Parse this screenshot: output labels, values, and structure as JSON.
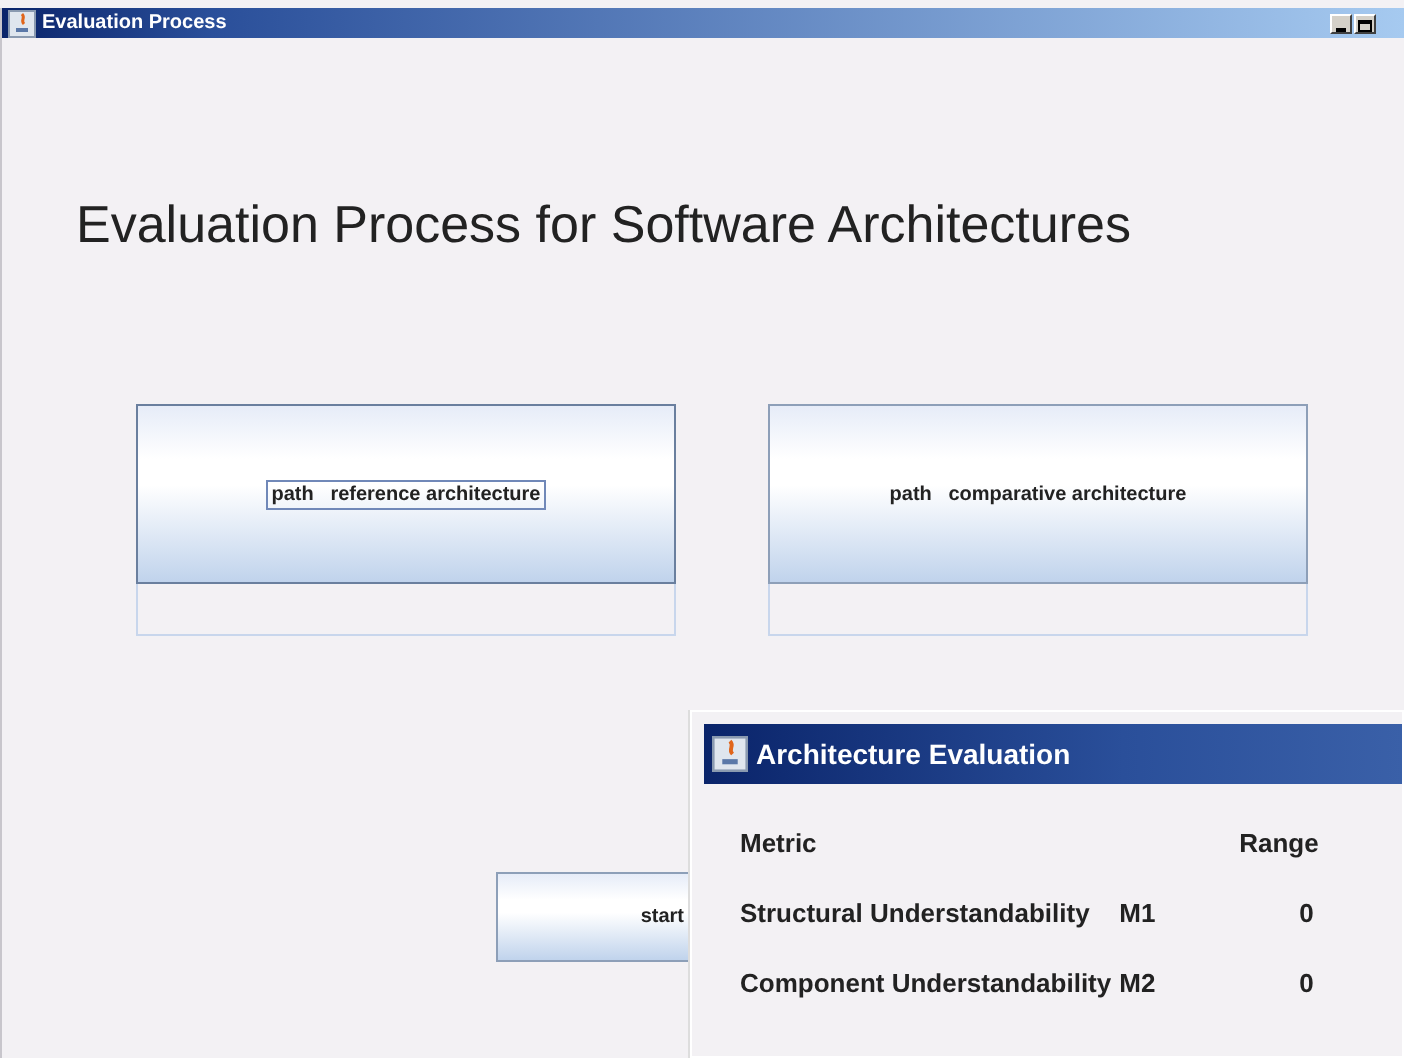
{
  "window": {
    "title": "Evaluation Process"
  },
  "heading": "Evaluation Process for Software Architectures",
  "path_buttons": [
    {
      "label": "path   reference architecture",
      "focused": true
    },
    {
      "label": "path   comparative architecture",
      "focused": false
    }
  ],
  "start_button": {
    "label": "start"
  },
  "dialog": {
    "title": "Architecture Evaluation",
    "columns": [
      "Metric",
      "Range"
    ],
    "rows": [
      {
        "metric": "Structural Understandability",
        "id": "M1",
        "range": "0"
      },
      {
        "metric": "Component Understandability",
        "id": "M2",
        "range": "0"
      }
    ]
  }
}
